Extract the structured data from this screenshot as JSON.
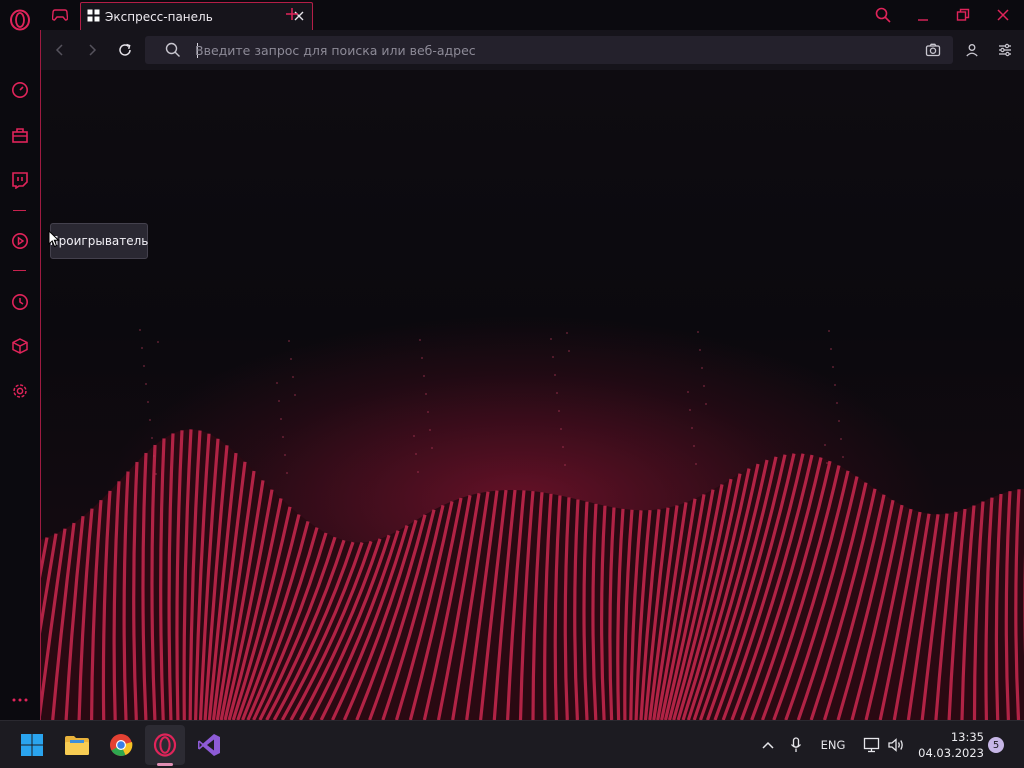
{
  "browser": {
    "tab": {
      "title": "Экспресс-панель"
    },
    "address": {
      "placeholder": "Введите запрос для поиска или веб-адрес",
      "value": ""
    },
    "tooltip": {
      "text": "Проигрыватель"
    }
  },
  "sidebar": {
    "items": [
      {
        "icon": "opera-logo-icon"
      },
      {
        "icon": "speed-dial-icon"
      },
      {
        "icon": "gx-corner-icon"
      },
      {
        "icon": "twitch-icon"
      },
      {
        "icon": "player-icon"
      },
      {
        "icon": "history-icon"
      },
      {
        "icon": "extensions-icon"
      },
      {
        "icon": "settings-icon"
      },
      {
        "icon": "more-icon"
      }
    ]
  },
  "taskbar": {
    "language": "ENG",
    "time": "13:35",
    "date": "04.03.2023",
    "notification_count": "5"
  },
  "colors": {
    "accent": "#e0245a",
    "background": "#0b0a0f",
    "toolbar": "#16141b",
    "taskbar": "#1c1b21"
  }
}
